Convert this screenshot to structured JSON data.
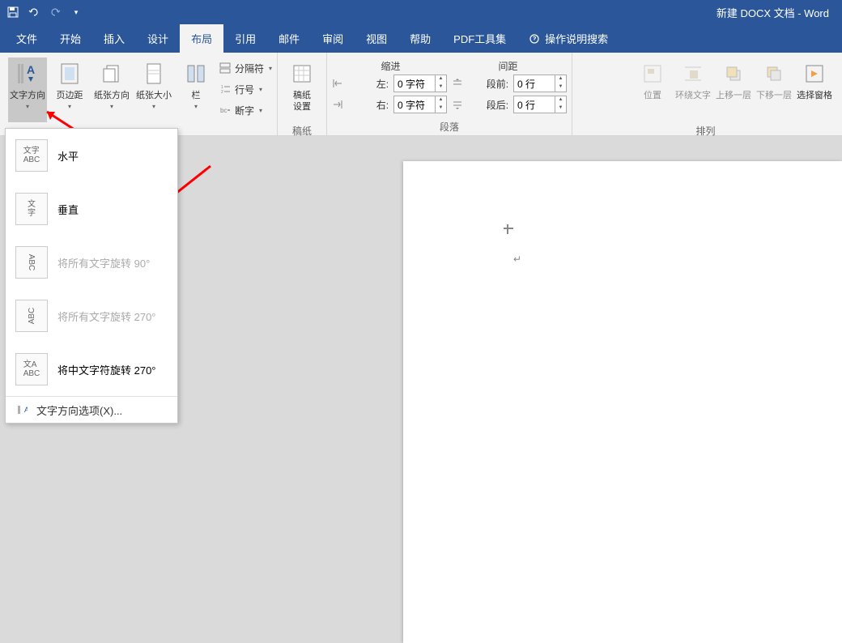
{
  "title": "新建 DOCX 文档 - Word",
  "tabs": {
    "file": "文件",
    "home": "开始",
    "insert": "插入",
    "design": "设计",
    "layout": "布局",
    "references": "引用",
    "mailings": "邮件",
    "review": "审阅",
    "view": "视图",
    "help": "帮助",
    "pdf": "PDF工具集",
    "tellme": "操作说明搜索"
  },
  "ribbon": {
    "text_direction": "文字方向",
    "margins": "页边距",
    "orientation": "纸张方向",
    "size": "纸张大小",
    "columns": "栏",
    "breaks": "分隔符",
    "line_numbers": "行号",
    "hyphenation": "断字",
    "manuscript": "稿纸",
    "manuscript_settings": "设置",
    "indent_header": "缩进",
    "spacing_header": "间距",
    "indent_left_label": "左:",
    "indent_right_label": "右:",
    "indent_left_value": "0 字符",
    "indent_right_value": "0 字符",
    "spacing_before_label": "段前:",
    "spacing_after_label": "段后:",
    "spacing_before_value": "0 行",
    "spacing_after_value": "0 行",
    "position": "位置",
    "wrap_text": "环绕文字",
    "bring_forward": "上移一层",
    "send_backward": "下移一层",
    "selection_pane": "选择窗格",
    "group_paragraph": "段落",
    "group_manuscript": "稿纸",
    "group_arrange": "排列"
  },
  "dropdown": {
    "horizontal": "水平",
    "vertical": "垂直",
    "rotate90": "将所有文字旋转 90°",
    "rotate270": "将所有文字旋转 270°",
    "rotate_cjk_270": "将中文字符旋转 270°",
    "options": "文字方向选项(X)...",
    "icon_h": "文字\nABC",
    "icon_v": "文\n字",
    "icon_90": "ABC",
    "icon_270": "ABC",
    "icon_cjk": "文A\nABC"
  },
  "page_mark": "↵"
}
